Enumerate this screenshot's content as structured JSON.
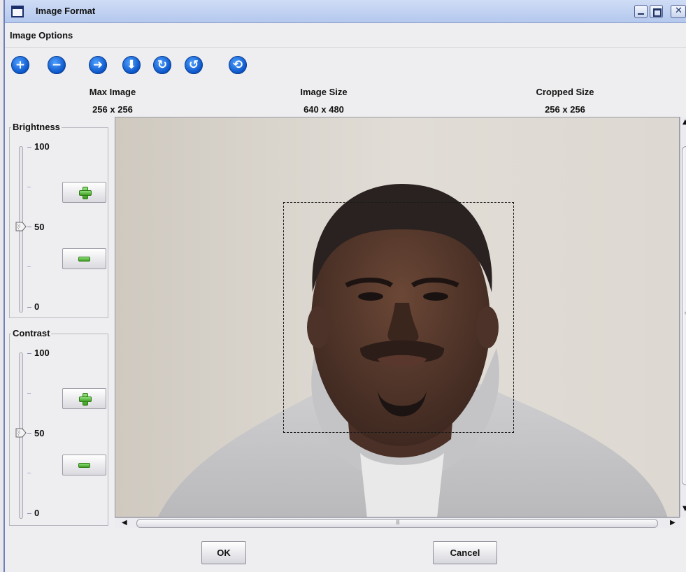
{
  "window": {
    "title": "Image Format"
  },
  "menu": {
    "image_options": "Image Options"
  },
  "toolbar": {
    "icons": [
      "zoom-in-icon",
      "zoom-out-icon",
      "rotate-right-icon",
      "flip-down-icon",
      "rotate-cw-icon",
      "rotate-ccw-icon",
      "reset-icon"
    ]
  },
  "header": {
    "max_image_label": "Max Image",
    "max_image_value": "256 x 256",
    "image_size_label": "Image Size",
    "image_size_value": "640 x 480",
    "cropped_size_label": "Cropped Size",
    "cropped_size_value": "256 x 256"
  },
  "brightness": {
    "title": "Brightness",
    "max": "100",
    "mid": "50",
    "min": "0",
    "value": 50
  },
  "contrast": {
    "title": "Contrast",
    "max": "100",
    "mid": "50",
    "min": "0",
    "value": 50
  },
  "scroll": {
    "h_grip": "III"
  },
  "buttons": {
    "ok": "OK",
    "cancel": "Cancel"
  },
  "colors": {
    "accent": "#0b55c9",
    "plus_green": "#3f9d22",
    "wall": "#ddd8d1",
    "hoodie": "#c8c8ca"
  }
}
